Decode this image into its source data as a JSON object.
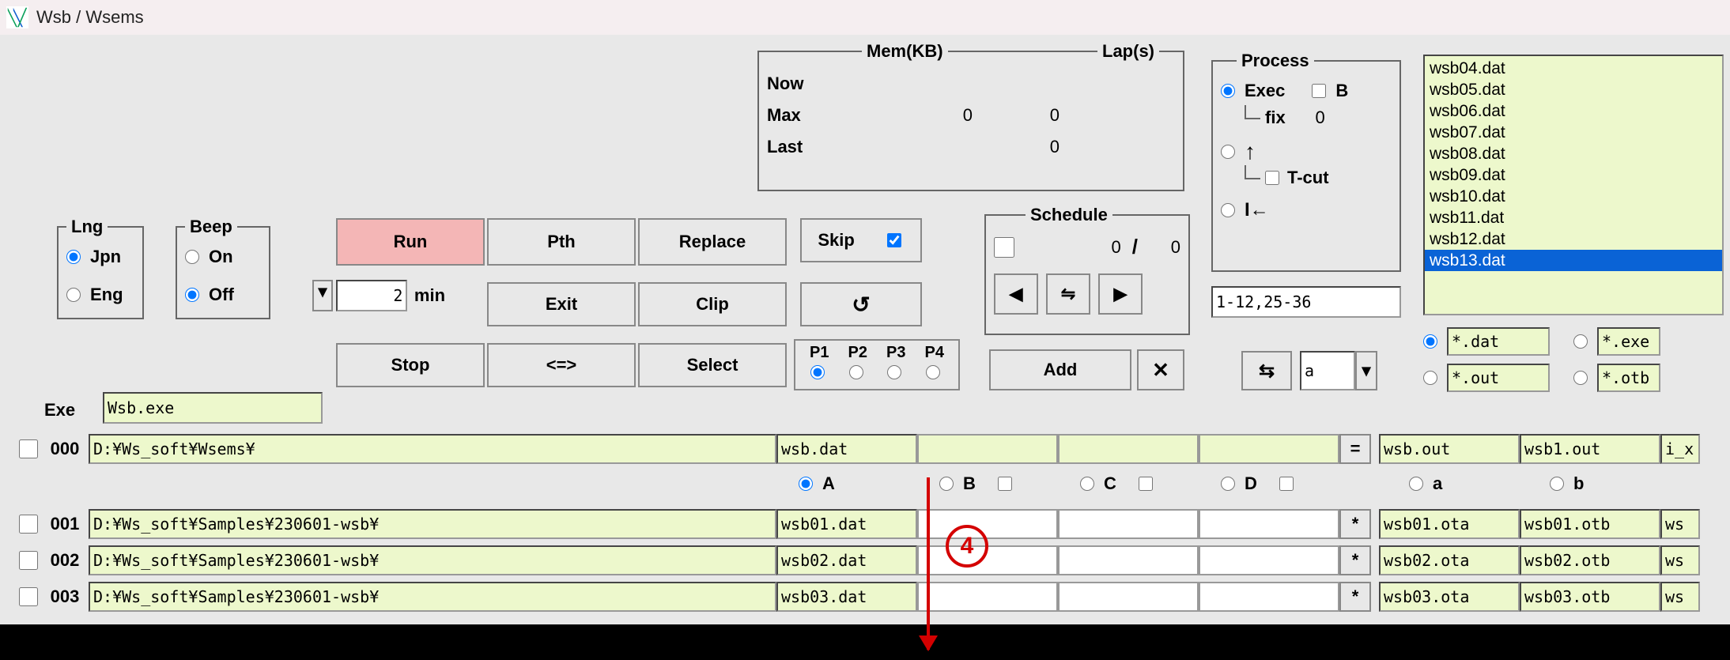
{
  "window": {
    "title": "Wsb / Wsems"
  },
  "lng": {
    "legend": "Lng",
    "opt_jpn": "Jpn",
    "opt_eng": "Eng",
    "selected": "Jpn"
  },
  "beep": {
    "legend": "Beep",
    "opt_on": "On",
    "opt_off": "Off",
    "selected": "Off"
  },
  "minbox": {
    "value": "2",
    "unit": "min"
  },
  "buttons": {
    "run": "Run",
    "pth": "Pth",
    "replace": "Replace",
    "exit": "Exit",
    "clip": "Clip",
    "stop": "Stop",
    "swap_arrows": "<=>",
    "select": "Select",
    "refresh": "↺",
    "add": "Add",
    "close": "✕",
    "swap_horiz": "⇆",
    "equals": "=",
    "star": "*"
  },
  "skip": {
    "label": "Skip",
    "checked": true
  },
  "p_tabs": {
    "p1": "P1",
    "p2": "P2",
    "p3": "P3",
    "p4": "P4",
    "selected": "P1"
  },
  "mem": {
    "title_mem": "Mem(KB)",
    "title_lap": "Lap(s)",
    "now_label": "Now",
    "now_mem": "",
    "now_lap": "",
    "max_label": "Max",
    "max_mem": "0",
    "max_lap": "0",
    "last_label": "Last",
    "last_mem": "",
    "last_lap": "0"
  },
  "schedule": {
    "legend": "Schedule",
    "cur": "0",
    "total": "0",
    "slash": "/",
    "prev": "◀",
    "mid": "⇋",
    "next": "▶"
  },
  "process": {
    "legend": "Process",
    "exec": "Exec",
    "b_label": "B",
    "fix_label": "fix",
    "fix_value": "0",
    "up_arrow": "↑",
    "tcut": "T-cut",
    "back_arrow": "I←",
    "range": "1-12,25-36",
    "a_value": "a"
  },
  "filelist": {
    "items": [
      "wsb04.dat",
      "wsb05.dat",
      "wsb06.dat",
      "wsb07.dat",
      "wsb08.dat",
      "wsb09.dat",
      "wsb10.dat",
      "wsb11.dat",
      "wsb12.dat",
      "wsb13.dat"
    ],
    "selected_index": 9
  },
  "ext_filters": {
    "dat": "*.dat",
    "exe": "*.exe",
    "out": "*.out",
    "otb": "*.otb",
    "selected": "dat"
  },
  "exe": {
    "label": "Exe",
    "value": "Wsb.exe"
  },
  "row000": {
    "num": "000",
    "path": "D:¥Ws_soft¥Wsems¥",
    "file": "wsb.dat",
    "out_a": "wsb.out",
    "out_b": "wsb1.out",
    "out_c": "i_xz"
  },
  "col_headers": {
    "A": "A",
    "B": "B",
    "C": "C",
    "D": "D",
    "a": "a",
    "b": "b",
    "selected": "A"
  },
  "rows": [
    {
      "num": "001",
      "path": "D:¥Ws_soft¥Samples¥230601-wsb¥",
      "file": "wsb01.dat",
      "ota": "wsb01.ota",
      "otb": "wsb01.otb",
      "ws": "ws"
    },
    {
      "num": "002",
      "path": "D:¥Ws_soft¥Samples¥230601-wsb¥",
      "file": "wsb02.dat",
      "ota": "wsb02.ota",
      "otb": "wsb02.otb",
      "ws": "ws"
    },
    {
      "num": "003",
      "path": "D:¥Ws_soft¥Samples¥230601-wsb¥",
      "file": "wsb03.dat",
      "ota": "wsb03.ota",
      "otb": "wsb03.otb",
      "ws": "ws"
    }
  ],
  "annotation": {
    "label": "4"
  }
}
